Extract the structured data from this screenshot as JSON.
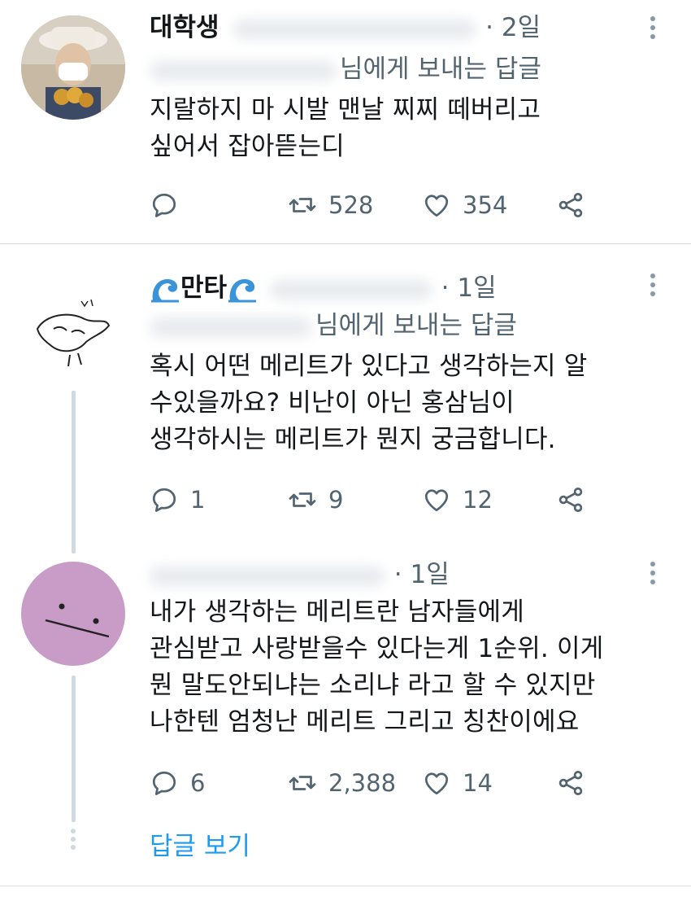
{
  "tweets": [
    {
      "name": "대학생",
      "time": "· 2일",
      "reply_to": "님에게 보내는 답글",
      "text": "지랄하지 마 시발 맨날 찌찌 떼버리고\n싶어서 잡아뜯는디",
      "replies": "",
      "retweets": "528",
      "likes": "354"
    },
    {
      "name": "만타",
      "time": "· 1일",
      "reply_to": "님에게 보내는 답글",
      "text": "혹시 어떤 메리트가 있다고 생각하는지 알\n수있을까요? 비난이 아닌 홍삼님이\n생각하시는 메리트가 뭔지 궁금합니다.",
      "replies": "1",
      "retweets": "9",
      "likes": "12"
    },
    {
      "name": "",
      "time": "· 1일",
      "text": "내가 생각하는 메리트란 남자들에게\n관심받고 사랑받을수 있다는게 1순위. 이게\n뭔 말도안되냐는 소리냐 라고 할 수 있지만\n나한텐 엄청난 메리트 그리고 칭찬이에요",
      "replies": "6",
      "retweets": "2,388",
      "likes": "14"
    }
  ],
  "view_replies_label": "답글 보기",
  "colors": {
    "accent": "#1d9bf0",
    "secondary_text": "#536471",
    "avatar3_bg": "#c99bc7"
  },
  "icons": [
    "reply-icon",
    "retweet-icon",
    "like-icon",
    "share-icon",
    "more-icon",
    "wave-emoji-icon"
  ]
}
